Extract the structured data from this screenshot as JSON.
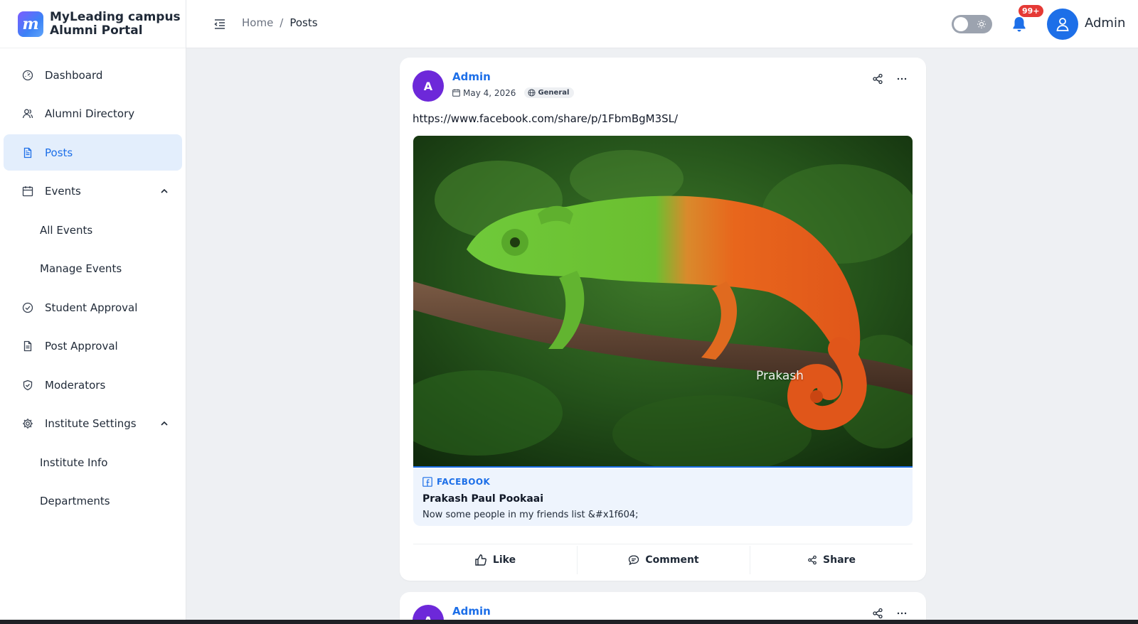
{
  "brand": {
    "logo_letter": "m",
    "name_line1": "MyLeading campus",
    "name_line2": "Alumni Portal"
  },
  "sidebar": {
    "items": [
      {
        "label": "Dashboard",
        "icon": "gauge-icon"
      },
      {
        "label": "Alumni Directory",
        "icon": "users-icon"
      },
      {
        "label": "Posts",
        "icon": "document-icon",
        "active": true
      },
      {
        "label": "Events",
        "icon": "calendar-icon",
        "expanded": true,
        "children": [
          "All Events",
          "Manage Events"
        ]
      },
      {
        "label": "Student Approval",
        "icon": "check-circle-icon"
      },
      {
        "label": "Post Approval",
        "icon": "file-check-icon"
      },
      {
        "label": "Moderators",
        "icon": "shield-check-icon"
      },
      {
        "label": "Institute Settings",
        "icon": "gear-icon",
        "expanded": true,
        "children": [
          "Institute Info",
          "Departments"
        ]
      }
    ]
  },
  "header": {
    "breadcrumb": {
      "home": "Home",
      "separator": "/",
      "current": "Posts"
    },
    "notifications_badge": "99+",
    "user_name": "Admin"
  },
  "posts": [
    {
      "avatar_letter": "A",
      "author": "Admin",
      "date": "May 4, 2026",
      "tag": "General",
      "text": "https://www.facebook.com/share/p/1FbmBgM3SL/",
      "image": {
        "subject": "chameleon-on-branch",
        "watermark": "Prakash"
      },
      "link_preview": {
        "source": "FACEBOOK",
        "title": "Prakash Paul Pookaai",
        "description": "Now some people in my friends list &#x1f604;"
      },
      "actions": {
        "like": "Like",
        "comment": "Comment",
        "share": "Share"
      }
    },
    {
      "avatar_letter": "A",
      "author": "Admin"
    }
  ],
  "colors": {
    "accent": "#1d6fe8",
    "avatar": "#6d28d9",
    "badge": "#e53935",
    "active_bg": "#e3eefc"
  }
}
